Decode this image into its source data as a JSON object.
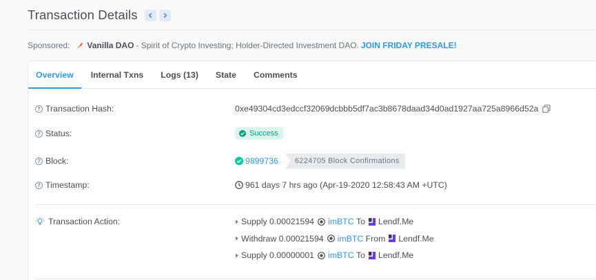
{
  "header": {
    "title": "Transaction Details",
    "prev_icon": "chevron-left-icon",
    "next_icon": "chevron-right-icon"
  },
  "sponsored": {
    "label": "Sponsored:",
    "name": "Vanilla DAO",
    "description": "- Spirit of Crypto Investing; Holder-Directed Investment DAO.",
    "cta": "JOIN FRIDAY PRESALE!"
  },
  "tabs": [
    {
      "label": "Overview",
      "active": true
    },
    {
      "label": "Internal Txns",
      "active": false
    },
    {
      "label": "Logs (13)",
      "active": false
    },
    {
      "label": "State",
      "active": false
    },
    {
      "label": "Comments",
      "active": false
    }
  ],
  "details": {
    "hash": {
      "label": "Transaction Hash:",
      "value": "0xe49304cd3edccf32069dcbbb5df7ac3b8678daad34d0ad1927aa725a8966d52a"
    },
    "status": {
      "label": "Status:",
      "value": "Success"
    },
    "block": {
      "label": "Block:",
      "number": "9899736",
      "confirmations": "6224705 Block Confirmations"
    },
    "timestamp": {
      "label": "Timestamp:",
      "value": "961 days 7 hrs ago (Apr-19-2020 12:58:43 AM +UTC)"
    },
    "action": {
      "label": "Transaction Action:",
      "items": [
        {
          "verb": "Supply",
          "amount": "0.00021594",
          "token": "imBTC",
          "prep": "To",
          "target": "Lendf.Me"
        },
        {
          "verb": "Withdraw",
          "amount": "0.00021594",
          "token": "imBTC",
          "prep": "From",
          "target": "Lendf.Me"
        },
        {
          "verb": "Supply",
          "amount": "0.00000001",
          "token": "imBTC",
          "prep": "To",
          "target": "Lendf.Me"
        }
      ]
    }
  },
  "colors": {
    "accent": "#3498db",
    "success_bg": "#dcf5ec",
    "success_text": "#00a186",
    "text": "#4a4f55"
  }
}
